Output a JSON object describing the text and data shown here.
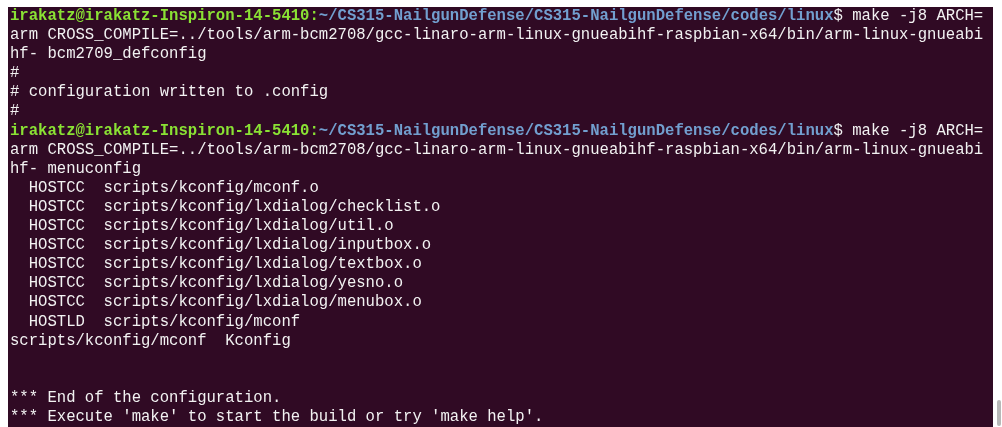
{
  "terminal": {
    "lines": [
      {
        "kind": "prompt",
        "user_host": "irakatz@irakatz-Inspiron-14-5410:",
        "path": "~/CS315-NailgunDefense/CS315-NailgunDefense/codes/linux",
        "command": "$ make -j8 ARCH="
      },
      {
        "kind": "text",
        "text": "arm CROSS_COMPILE=../tools/arm-bcm2708/gcc-linaro-arm-linux-gnueabihf-raspbian-x64/bin/arm-linux-gnueabi"
      },
      {
        "kind": "text",
        "text": "hf- bcm2709_defconfig"
      },
      {
        "kind": "text",
        "text": "#"
      },
      {
        "kind": "text",
        "text": "# configuration written to .config"
      },
      {
        "kind": "text",
        "text": "#"
      },
      {
        "kind": "prompt",
        "user_host": "irakatz@irakatz-Inspiron-14-5410:",
        "path": "~/CS315-NailgunDefense/CS315-NailgunDefense/codes/linux",
        "command": "$ make -j8 ARCH="
      },
      {
        "kind": "text",
        "text": "arm CROSS_COMPILE=../tools/arm-bcm2708/gcc-linaro-arm-linux-gnueabihf-raspbian-x64/bin/arm-linux-gnueabi"
      },
      {
        "kind": "text",
        "text": "hf- menuconfig"
      },
      {
        "kind": "text",
        "text": "  HOSTCC  scripts/kconfig/mconf.o"
      },
      {
        "kind": "text",
        "text": "  HOSTCC  scripts/kconfig/lxdialog/checklist.o"
      },
      {
        "kind": "text",
        "text": "  HOSTCC  scripts/kconfig/lxdialog/util.o"
      },
      {
        "kind": "text",
        "text": "  HOSTCC  scripts/kconfig/lxdialog/inputbox.o"
      },
      {
        "kind": "text",
        "text": "  HOSTCC  scripts/kconfig/lxdialog/textbox.o"
      },
      {
        "kind": "text",
        "text": "  HOSTCC  scripts/kconfig/lxdialog/yesno.o"
      },
      {
        "kind": "text",
        "text": "  HOSTCC  scripts/kconfig/lxdialog/menubox.o"
      },
      {
        "kind": "text",
        "text": "  HOSTLD  scripts/kconfig/mconf"
      },
      {
        "kind": "text",
        "text": "scripts/kconfig/mconf  Kconfig"
      },
      {
        "kind": "blank"
      },
      {
        "kind": "blank"
      },
      {
        "kind": "text",
        "text": "*** End of the configuration."
      },
      {
        "kind": "text",
        "text": "*** Execute 'make' to start the build or try 'make help'."
      }
    ]
  }
}
